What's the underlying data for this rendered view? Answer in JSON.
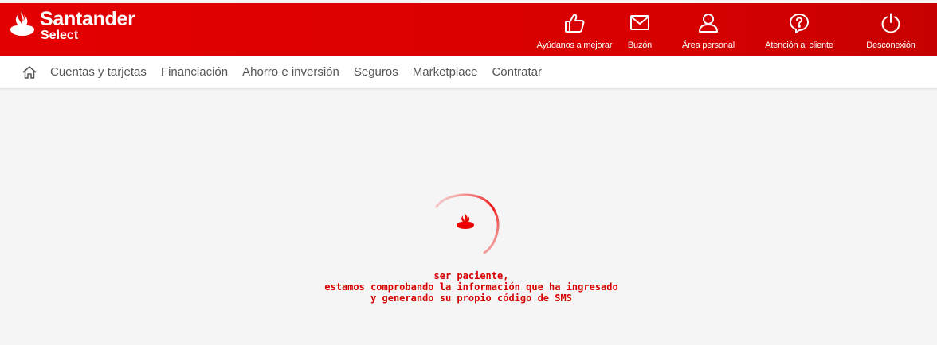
{
  "brand": {
    "name": "Santander",
    "sub": "Select",
    "color": "#ec0000"
  },
  "top_actions": [
    {
      "label": "Ayúdanos a mejorar",
      "icon": "thumbs-up-icon"
    },
    {
      "label": "Buzón",
      "icon": "mail-icon"
    },
    {
      "label": "Área personal",
      "icon": "user-icon"
    },
    {
      "label": "Atención al cliente",
      "icon": "help-icon"
    },
    {
      "label": "Desconexión",
      "icon": "power-icon"
    }
  ],
  "nav": {
    "home_icon": "home-icon",
    "items": [
      "Cuentas y tarjetas",
      "Financiación",
      "Ahorro e inversión",
      "Seguros",
      "Marketplace",
      "Contratar"
    ]
  },
  "loading": {
    "lines": [
      "ser paciente,",
      "estamos comprobando la información que ha ingresado",
      "y generando su propio código de SMS"
    ],
    "color": "#d60000"
  }
}
